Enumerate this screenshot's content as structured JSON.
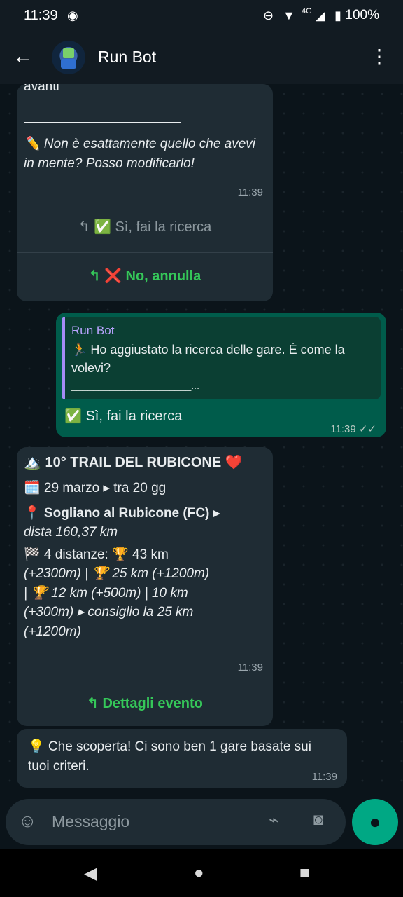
{
  "status_bar": {
    "time": "11:39",
    "battery": "100%",
    "network": "4G"
  },
  "header": {
    "title": "Run Bot"
  },
  "messages": {
    "first": {
      "top_text": "avanti",
      "body": "✏️ Non è esattamente quello che avevi in mente? Posso modificarlo!",
      "time": "11:39",
      "btn_yes": "↰ ✅ Sì, fai la ricerca",
      "btn_no": "↰ ❌ No, annulla"
    },
    "reply": {
      "quote_author": "Run Bot",
      "quote_text": "🏃 Ho aggiustato la ricerca delle gare. È come la volevi?",
      "quote_rule": "______________________...",
      "text": "✅ Sì, fai la ricerca",
      "time": "11:39 ✓✓"
    },
    "event": {
      "title_line": "🏔️ 10° TRAIL DEL RUBICONE ❤️",
      "date_line": "🗓️ 29 marzo ▸ tra 20 gg",
      "place_line": "📍 Sogliano al Rubicone (FC) ▸",
      "distance_line": "dista 160,37 km",
      "course_line1": "🏁 4 distanze: 🏆 43 km",
      "course_line2": "(+2300m) | 🏆 25 km (+1200m)",
      "course_line3": "| 🏆 12 km (+500m) | 10 km",
      "course_line4": "(+300m) ▸ consiglio la 25 km",
      "course_line5": "(+1200m)",
      "time": "11:39",
      "button": "↰ Dettagli evento"
    },
    "last": {
      "text": "💡 Che scoperta! Ci sono ben 1 gare basate sui tuoi criteri.",
      "time": "11:39"
    }
  },
  "composer": {
    "placeholder": "Messaggio"
  }
}
